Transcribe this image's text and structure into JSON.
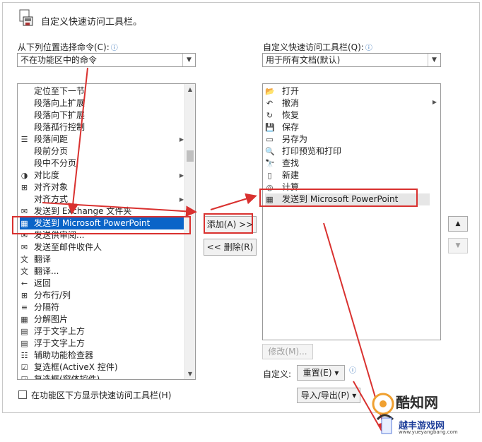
{
  "dialog": {
    "title": "自定义快速访问工具栏。"
  },
  "left": {
    "choose_label": "从下列位置选择命令(C):",
    "info": "ⓘ",
    "dropdown_value": "不在功能区中的命令",
    "items": [
      {
        "label": "定位至下一节",
        "icon": "",
        "sub": ""
      },
      {
        "label": "段落向上扩展",
        "icon": "",
        "sub": ""
      },
      {
        "label": "段落向下扩展",
        "icon": "",
        "sub": ""
      },
      {
        "label": "段落孤行控制",
        "icon": "",
        "sub": ""
      },
      {
        "label": "段落间距",
        "icon": "☰",
        "sub": "▶"
      },
      {
        "label": "段前分页",
        "icon": "",
        "sub": ""
      },
      {
        "label": "段中不分页",
        "icon": "",
        "sub": ""
      },
      {
        "label": "对比度",
        "icon": "◑",
        "sub": "▶"
      },
      {
        "label": "对齐对象",
        "icon": "⊞",
        "sub": ""
      },
      {
        "label": "对齐方式",
        "icon": "",
        "sub": "▶"
      },
      {
        "label": "发送到 Exchange 文件夹",
        "icon": "✉",
        "sub": ""
      },
      {
        "label": "发送到 Microsoft PowerPoint",
        "icon": "▦",
        "sub": ""
      },
      {
        "label": "发送供审阅...",
        "icon": "✉",
        "sub": ""
      },
      {
        "label": "发送至邮件收件人",
        "icon": "✉",
        "sub": ""
      },
      {
        "label": "翻译",
        "icon": "文",
        "sub": ""
      },
      {
        "label": "翻译...",
        "icon": "文",
        "sub": ""
      },
      {
        "label": "返回",
        "icon": "←",
        "sub": ""
      },
      {
        "label": "分布行/列",
        "icon": "⊞",
        "sub": ""
      },
      {
        "label": "分隔符",
        "icon": "≡",
        "sub": ""
      },
      {
        "label": "分解图片",
        "icon": "▦",
        "sub": ""
      },
      {
        "label": "浮于文字上方",
        "icon": "▤",
        "sub": ""
      },
      {
        "label": "浮于文字上方",
        "icon": "▤",
        "sub": ""
      },
      {
        "label": "辅助功能检查器",
        "icon": "☷",
        "sub": ""
      },
      {
        "label": "复选框(ActiveX 控件)",
        "icon": "☑",
        "sub": ""
      },
      {
        "label": "复选框(窗体控件)",
        "icon": "☑",
        "sub": ""
      }
    ],
    "checkbox_label": "在功能区下方显示快速访问工具栏(H)"
  },
  "middle": {
    "add_label": "添加(A) >>",
    "remove_label": "<< 删除(R)"
  },
  "right": {
    "customize_label": "自定义快速访问工具栏(Q):",
    "info": "ⓘ",
    "dropdown_value": "用于所有文档(默认)",
    "items": [
      {
        "label": "打开",
        "icon": "📂"
      },
      {
        "label": "撤消",
        "icon": "↶"
      },
      {
        "label": "恢复",
        "icon": "↻"
      },
      {
        "label": "保存",
        "icon": "💾"
      },
      {
        "label": "另存为",
        "icon": "▭"
      },
      {
        "label": "打印预览和打印",
        "icon": "🔍"
      },
      {
        "label": "查找",
        "icon": "🔭"
      },
      {
        "label": "新建",
        "icon": "▯"
      },
      {
        "label": "计算",
        "icon": "◎"
      },
      {
        "label": "发送到 Microsoft PowerPoint",
        "icon": "▦"
      }
    ],
    "modify_label": "修改(M)...",
    "customize_row_label": "自定义:",
    "reset_label": "重置(E) ▾",
    "import_label": "导入/导出(P) ▾",
    "move_up": "▲",
    "move_down": "▼"
  },
  "watermark": {
    "text1": "酷知网",
    "text2": "越丰游戏网",
    "text3": "www.yueyangbang.com"
  },
  "colors": {
    "selection": "#0a64c8",
    "annotation_red": "#d9312f"
  }
}
